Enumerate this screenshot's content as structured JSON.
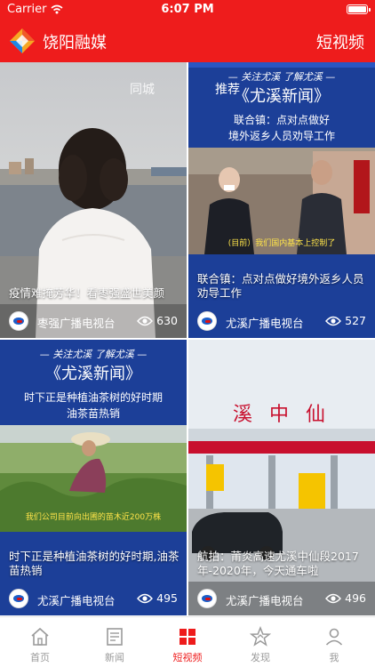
{
  "status_bar": {
    "carrier": "Carrier",
    "time": "6:07 PM"
  },
  "header": {
    "app_name": "饶阳融媒",
    "right_action": "短视频"
  },
  "cards": [
    {
      "tag": "同城",
      "title": "疫情难掩芳华！看枣强盛世美颜",
      "source": "枣强广播电视台",
      "views": "630"
    },
    {
      "badge": "推荐",
      "slogan": "— 关注尤溪 了解尤溪 —",
      "program": "《尤溪新闻》",
      "headline_1": "联合镇：点对点做好",
      "headline_2": "境外返乡人员劝导工作",
      "caption": "(目前）我们国内基本上控制了",
      "title": "联合镇：点对点做好境外返乡人员劝导工作",
      "source": "尤溪广播电视台",
      "views": "527"
    },
    {
      "slogan": "— 关注尤溪 了解尤溪 —",
      "program": "《尤溪新闻》",
      "headline_1": "时下正是种植油茶树的好时期",
      "headline_2": "油茶苗热销",
      "caption": "我们公司目前向出圃的苗木近200万株",
      "title": "时下正是种植油茶树的好时期,油茶苗热销",
      "source": "尤溪广播电视台",
      "views": "495"
    },
    {
      "sign": "溪 中 仙",
      "title": "航拍：莆炎高速尤溪中仙段2017年-2020年，今天通车啦",
      "source": "尤溪广播电视台",
      "views": "496"
    }
  ],
  "tabs": [
    {
      "label": "首页",
      "icon": "home-icon"
    },
    {
      "label": "新闻",
      "icon": "news-icon"
    },
    {
      "label": "短视频",
      "icon": "short-video-icon",
      "active": true
    },
    {
      "label": "发现",
      "icon": "discover-icon"
    },
    {
      "label": "我",
      "icon": "profile-icon"
    }
  ],
  "colors": {
    "brand_red": "#ee1c1c",
    "news_blue": "#1c3f98",
    "tab_inactive": "#9a9a9a"
  }
}
